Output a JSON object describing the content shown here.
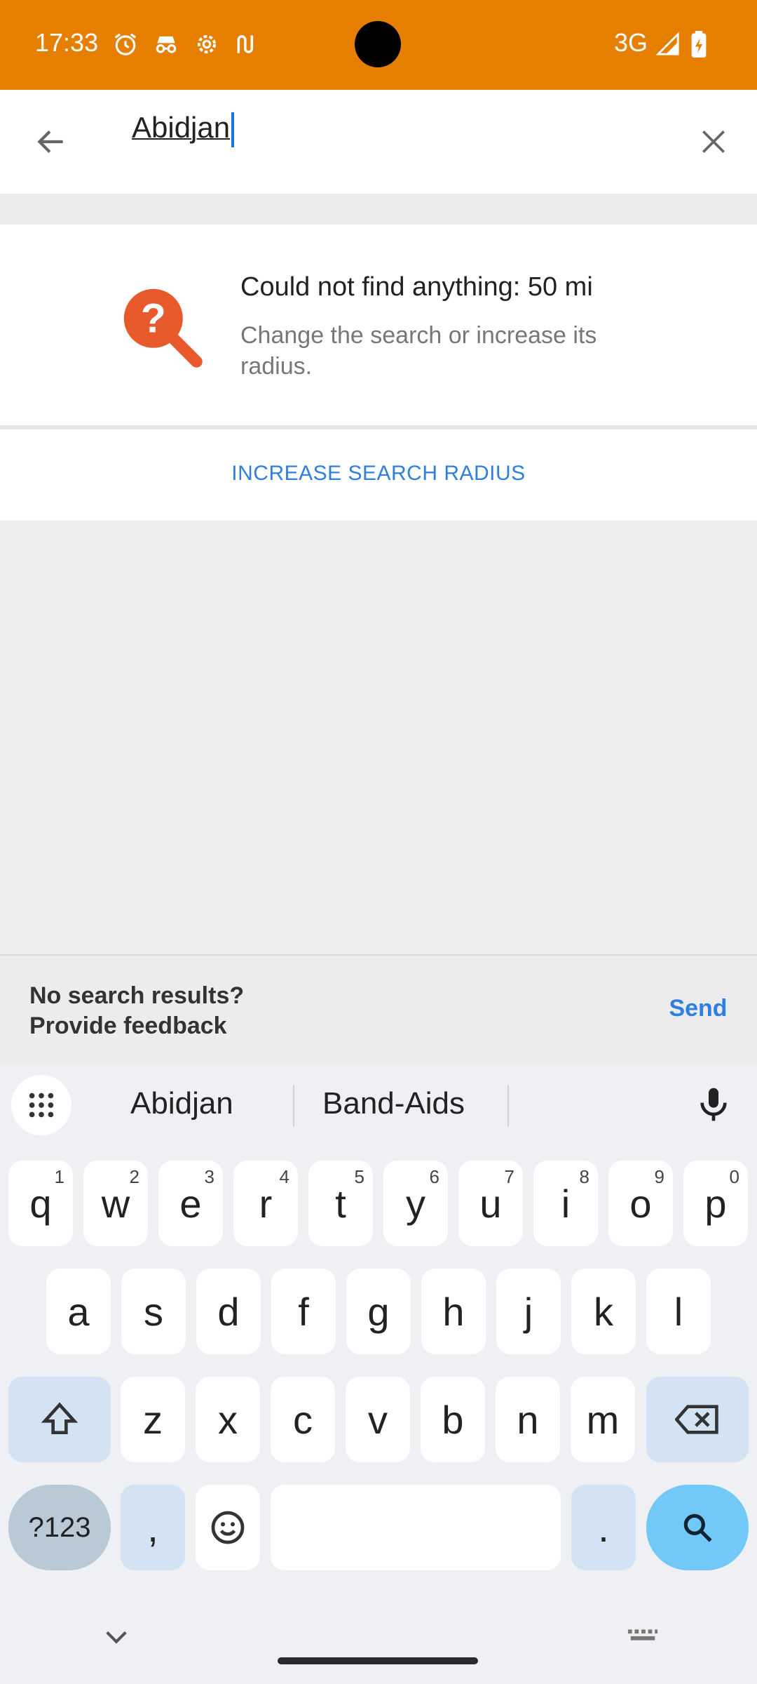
{
  "status_bar": {
    "time": "17:33",
    "network": "3G",
    "icons": [
      "alarm-icon",
      "incognito-icon",
      "settings-gear-icon",
      "vpn-key-icon",
      "signal-icon",
      "battery-charging-icon"
    ]
  },
  "search": {
    "value": "Abidjan",
    "icons": [
      "back-arrow-icon",
      "clear-x-icon"
    ]
  },
  "empty_state": {
    "title": "Could not find anything: 50 mi",
    "subtitle": "Change the search or increase its radius.",
    "icon": "search-question-icon",
    "icon_color": "#e85a2b"
  },
  "radius_button": {
    "label": "INCREASE SEARCH RADIUS",
    "color": "#2f7fe0"
  },
  "feedback": {
    "line1": "No search results?",
    "line2": "Provide feedback",
    "send_label": "Send"
  },
  "keyboard": {
    "suggestions": [
      "Abidjan",
      "Band-Aids"
    ],
    "row1": [
      {
        "k": "q",
        "h": "1"
      },
      {
        "k": "w",
        "h": "2"
      },
      {
        "k": "e",
        "h": "3"
      },
      {
        "k": "r",
        "h": "4"
      },
      {
        "k": "t",
        "h": "5"
      },
      {
        "k": "y",
        "h": "6"
      },
      {
        "k": "u",
        "h": "7"
      },
      {
        "k": "i",
        "h": "8"
      },
      {
        "k": "o",
        "h": "9"
      },
      {
        "k": "p",
        "h": "0"
      }
    ],
    "row2": [
      "a",
      "s",
      "d",
      "f",
      "g",
      "h",
      "j",
      "k",
      "l"
    ],
    "row3": [
      "z",
      "x",
      "c",
      "v",
      "b",
      "n",
      "m"
    ],
    "sym_label": "?123",
    "comma": ",",
    "period": "."
  },
  "colors": {
    "status_bar": "#e67e00",
    "accent": "#2f7fe0",
    "enter_key": "#72c8f7"
  }
}
